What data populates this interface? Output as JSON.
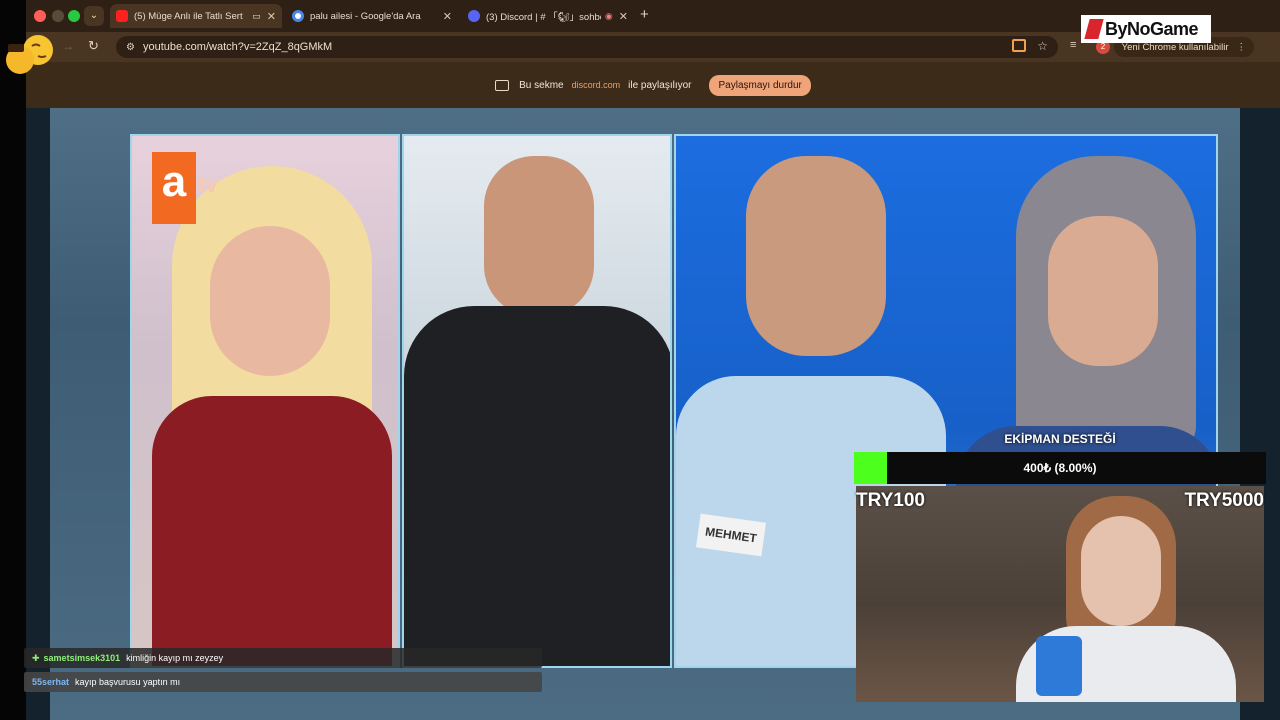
{
  "browser": {
    "tabs": [
      {
        "title": "(5) Müge Anlı ile Tatlı Sert",
        "favicon_color": "#ff2020",
        "active": true
      },
      {
        "title": "palu ailesi - Google'da Ara",
        "favicon_color": "#4a86e8",
        "active": false
      },
      {
        "title": "(3) Discord | # 「🐿」sohbe",
        "favicon_color": "#5865f2",
        "active": false
      }
    ],
    "new_tab_icon": "plus-icon",
    "url": "youtube.com/watch?v=2ZqZ_8qGMkM",
    "notification_badge": "2",
    "update_label": "Yeni Chrome kullanılabilir"
  },
  "share_bar": {
    "text_before": "Bu sekme",
    "domain": "discord.com",
    "text_after": "ile paylaşılıyor",
    "stop_button": "Paylaşmayı durdur"
  },
  "tv": {
    "channel_logo_a": "a",
    "channel_logo_tv": "tv",
    "name_tag": "MEHMET"
  },
  "donation": {
    "title": "EKİPMAN DESTEĞİ",
    "progress_text": "400₺ (8.00%)",
    "progress_fraction": 0.08,
    "min_label": "TRY100",
    "max_label": "TRY5000",
    "fill_color": "#4cff1c"
  },
  "chat": [
    {
      "user": "sametsimsek3101",
      "message": "kimliğin kayıp mı zeyzey",
      "badge_icon": "plus-badge-icon"
    },
    {
      "user": "55serhat",
      "message": "kayıp başvurusu yaptın mı",
      "badge_icon": ""
    }
  ],
  "sponsor": {
    "logo_text": "ByNoGame"
  }
}
